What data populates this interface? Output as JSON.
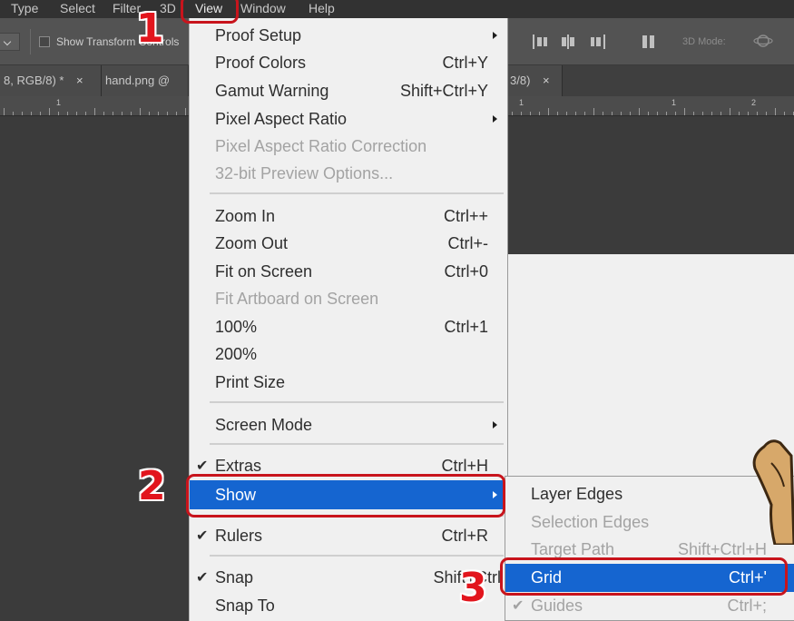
{
  "menubar": {
    "items": [
      "Type",
      "Select",
      "Filter",
      "3D",
      "View",
      "Window",
      "Help"
    ]
  },
  "options_bar": {
    "show_transform_controls": "Show Transform Controls",
    "mode_label": "3D Mode:"
  },
  "tabs": [
    {
      "label": "8, RGB/8) *",
      "close": "×"
    },
    {
      "label": "hand.png @",
      "close": ""
    },
    {
      "label": "3/8)",
      "close": "×"
    }
  ],
  "ruler": {
    "marks": [
      "1",
      "1",
      "1",
      "2"
    ]
  },
  "view_menu": {
    "items": [
      {
        "label": "Proof Setup",
        "shortcut": "",
        "submenu": true,
        "disabled": false,
        "checked": false
      },
      {
        "label": "Proof Colors",
        "shortcut": "Ctrl+Y",
        "submenu": false,
        "disabled": false,
        "checked": false
      },
      {
        "label": "Gamut Warning",
        "shortcut": "Shift+Ctrl+Y",
        "submenu": false,
        "disabled": false,
        "checked": false
      },
      {
        "label": "Pixel Aspect Ratio",
        "shortcut": "",
        "submenu": true,
        "disabled": false,
        "checked": false
      },
      {
        "label": "Pixel Aspect Ratio Correction",
        "shortcut": "",
        "submenu": false,
        "disabled": true,
        "checked": false
      },
      {
        "label": "32-bit Preview Options...",
        "shortcut": "",
        "submenu": false,
        "disabled": true,
        "checked": false
      },
      {
        "label": "Zoom In",
        "shortcut": "Ctrl++",
        "submenu": false,
        "disabled": false,
        "checked": false
      },
      {
        "label": "Zoom Out",
        "shortcut": "Ctrl+-",
        "submenu": false,
        "disabled": false,
        "checked": false
      },
      {
        "label": "Fit on Screen",
        "shortcut": "Ctrl+0",
        "submenu": false,
        "disabled": false,
        "checked": false
      },
      {
        "label": "Fit Artboard on Screen",
        "shortcut": "",
        "submenu": false,
        "disabled": true,
        "checked": false
      },
      {
        "label": "100%",
        "shortcut": "Ctrl+1",
        "submenu": false,
        "disabled": false,
        "checked": false
      },
      {
        "label": "200%",
        "shortcut": "",
        "submenu": false,
        "disabled": false,
        "checked": false
      },
      {
        "label": "Print Size",
        "shortcut": "",
        "submenu": false,
        "disabled": false,
        "checked": false
      },
      {
        "label": "Screen Mode",
        "shortcut": "",
        "submenu": true,
        "disabled": false,
        "checked": false
      },
      {
        "label": "Extras",
        "shortcut": "Ctrl+H",
        "submenu": false,
        "disabled": false,
        "checked": true
      },
      {
        "label": "Show",
        "shortcut": "",
        "submenu": true,
        "disabled": false,
        "checked": false,
        "highlighted": true
      },
      {
        "label": "Rulers",
        "shortcut": "Ctrl+R",
        "submenu": false,
        "disabled": false,
        "checked": true
      },
      {
        "label": "Snap",
        "shortcut": "Shift+Ctrl",
        "submenu": false,
        "disabled": false,
        "checked": true
      },
      {
        "label": "Snap To",
        "shortcut": "",
        "submenu": false,
        "disabled": false,
        "checked": false
      }
    ]
  },
  "show_submenu": {
    "items": [
      {
        "label": "Layer Edges",
        "shortcut": "",
        "disabled": false,
        "checked": false
      },
      {
        "label": "Selection Edges",
        "shortcut": "",
        "disabled": true,
        "checked": false
      },
      {
        "label": "Target Path",
        "shortcut": "Shift+Ctrl+H",
        "disabled": true,
        "checked": false
      },
      {
        "label": "Grid",
        "shortcut": "Ctrl+'",
        "disabled": false,
        "checked": false,
        "highlighted": true
      },
      {
        "label": "Guides",
        "shortcut": "Ctrl+;",
        "disabled": true,
        "checked": true
      }
    ]
  },
  "annotations": {
    "step1": "1",
    "step2": "2",
    "step3": "3"
  },
  "colors": {
    "highlight": "#1565d0",
    "callout": "#c8141c",
    "menu_bg": "#f0f0f0",
    "workspace_bg": "#3b3b3b"
  },
  "icons": {
    "checkmark": "✔",
    "submenu_arrow": "chevron-right-icon"
  }
}
